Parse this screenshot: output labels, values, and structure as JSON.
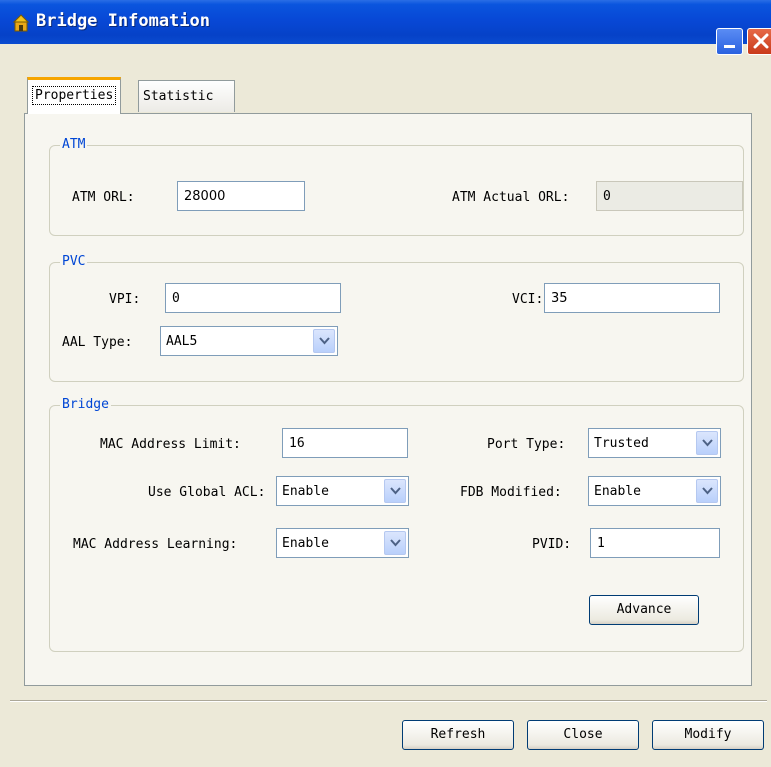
{
  "window": {
    "title": "Bridge Infomation"
  },
  "tabs": [
    {
      "label": "Properties"
    },
    {
      "label": "Statistic"
    }
  ],
  "atm": {
    "legend": "ATM",
    "orl_label": "ATM ORL:",
    "orl_value": "28000",
    "actual_label": "ATM Actual ORL:",
    "actual_value": "0"
  },
  "pvc": {
    "legend": "PVC",
    "vpi_label": "VPI:",
    "vpi_value": "0",
    "vci_label": "VCI:",
    "vci_value": "35",
    "aal_label": "AAL Type:",
    "aal_value": "AAL5"
  },
  "bridge": {
    "legend": "Bridge",
    "mac_limit_label": "MAC Address Limit:",
    "mac_limit_value": "16",
    "port_type_label": "Port Type:",
    "port_type_value": "Trusted",
    "global_acl_label": "Use Global ACL:",
    "global_acl_value": "Enable",
    "fdb_label": "FDB Modified:",
    "fdb_value": "Enable",
    "mac_learning_label": "MAC Address Learning:",
    "mac_learning_value": "Enable",
    "pvid_label": "PVID:",
    "pvid_value": "1",
    "advance_label": "Advance"
  },
  "footer": {
    "refresh_label": "Refresh",
    "close_label": "Close",
    "modify_label": "Modify"
  },
  "colors": {
    "titlebar": "#0848d6",
    "legend_text": "#0046d5",
    "window_bg": "#ece9d8"
  }
}
